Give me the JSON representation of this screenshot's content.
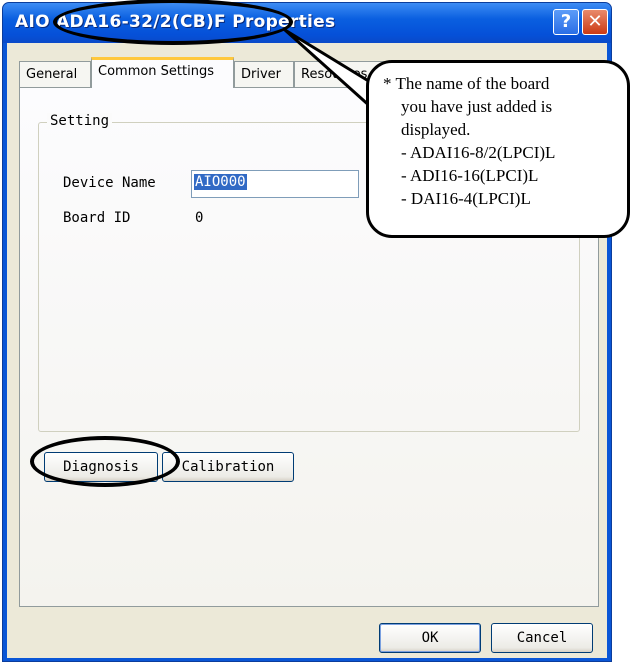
{
  "window": {
    "title": "AIO ADA16-32/2(CB)F Properties",
    "help_glyph": "?",
    "close_glyph": "✕",
    "colors": {
      "titlebar": "#0a5fe0",
      "client": "#ece9d8",
      "tab_highlight": "#ffc83c",
      "selection": "#316ac5"
    }
  },
  "tabs": [
    {
      "label": "General"
    },
    {
      "label": "Common Settings",
      "selected": true
    },
    {
      "label": "Driver"
    },
    {
      "label": "Resources"
    }
  ],
  "setting": {
    "legend": "Setting",
    "device_name_label": "Device Name",
    "device_name_value": "AIO000",
    "board_id_label": "Board ID",
    "board_id_value": "0"
  },
  "buttons": {
    "diagnosis": "Diagnosis",
    "calibration": "Calibration",
    "ok": "OK",
    "cancel": "Cancel"
  },
  "callout": {
    "lines": [
      "* The name of the board",
      "you have just added is",
      "displayed.",
      "- ADAI16-8/2(LPCI)L",
      "- ADI16-16(LPCI)L",
      "- DAI16-4(LPCI)L"
    ]
  }
}
